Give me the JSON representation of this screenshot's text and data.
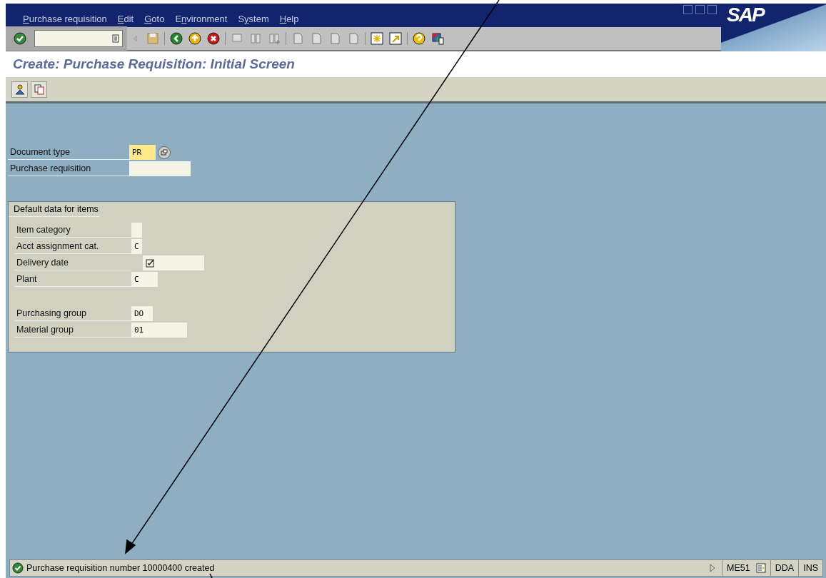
{
  "menu": [
    {
      "key": "P",
      "rest": "urchase requisition"
    },
    {
      "key": "E",
      "rest": "dit"
    },
    {
      "key": "G",
      "rest": "oto"
    },
    {
      "lead": "E",
      "key": "n",
      "rest": "vironment"
    },
    {
      "lead": "S",
      "key": "y",
      "rest": "stem"
    },
    {
      "key": "H",
      "rest": "elp"
    }
  ],
  "logo": "SAP",
  "title": "Create: Purchase Requisition: Initial Screen",
  "header_fields": [
    {
      "label": "Document type",
      "value": "PR",
      "focused": true,
      "matchcode": true
    },
    {
      "label": "Purchase requisition",
      "focused": false,
      "matchcode": false
    }
  ],
  "group": {
    "title": "Default data for items",
    "fields": [
      {
        "label": "Item category",
        "required": false,
        "gap_before": false
      },
      {
        "label": "Acct assignment cat.",
        "value": "C",
        "required": false,
        "gap_before": false
      },
      {
        "label": "Delivery date",
        "required": true,
        "gap_before": false
      },
      {
        "label": "Plant",
        "value": "C",
        "required": false,
        "gap_before": false
      },
      {
        "label": "Purchasing group",
        "value": "DO",
        "required": false,
        "gap_before": true
      },
      {
        "label": "Material group",
        "value": "01",
        "required": false,
        "gap_before": false
      }
    ]
  },
  "status_bar": {
    "message": "Purchase requisition number 10000400 created",
    "transaction": "ME51",
    "system": "DDA",
    "mode": "INS"
  }
}
